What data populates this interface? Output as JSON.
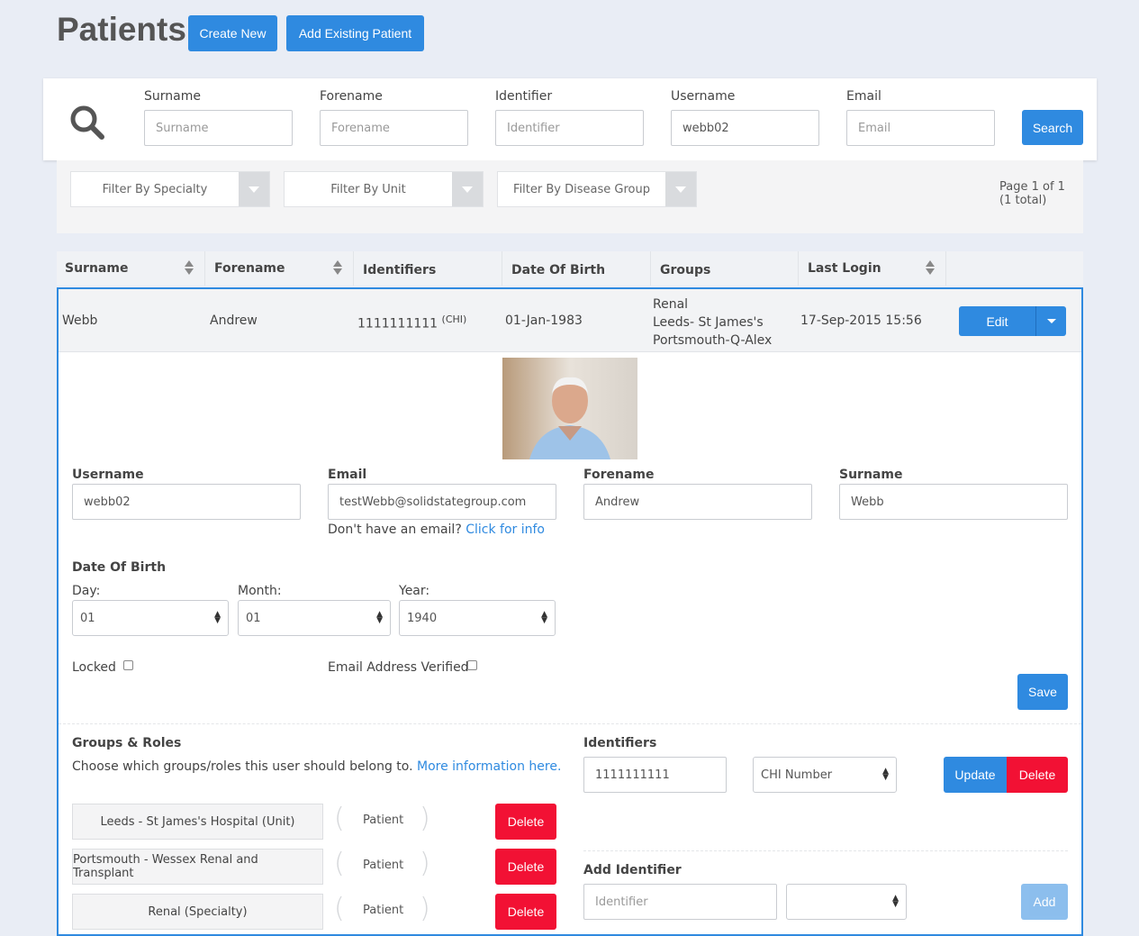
{
  "header": {
    "title": "Patients",
    "create_new": "Create New",
    "add_existing": "Add Existing Patient"
  },
  "search": {
    "icon": "search-icon",
    "surname_label": "Surname",
    "surname_placeholder": "Surname",
    "forename_label": "Forename",
    "forename_placeholder": "Forename",
    "identifier_label": "Identifier",
    "identifier_placeholder": "Identifier",
    "username_label": "Username",
    "username_value": "webb02",
    "email_label": "Email",
    "email_placeholder": "Email",
    "search_button": "Search"
  },
  "filters": {
    "specialty": "Filter By Specialty",
    "unit": "Filter By Unit",
    "disease_group": "Filter By Disease Group",
    "page_info_line1": "Page 1 of 1",
    "page_info_line2": "(1 total)"
  },
  "table": {
    "headers": [
      "Surname",
      "Forename",
      "Identifiers",
      "Date Of Birth",
      "Groups",
      "Last Login"
    ],
    "row": {
      "surname": "Webb",
      "forename": "Andrew",
      "identifier": "1111111111",
      "identifier_type": "(CHI)",
      "dob": "01-Jan-1983",
      "groups": [
        "Renal",
        "Leeds- St James's",
        "Portsmouth-Q-Alex"
      ],
      "last_login": "17-Sep-2015 15:56",
      "edit_button": "Edit"
    }
  },
  "detail": {
    "username_label": "Username",
    "username_value": "webb02",
    "email_label": "Email",
    "email_value": "testWebb@solidstategroup.com",
    "no_email_text": "Don't have an email?",
    "no_email_link": "Click for info",
    "forename_label": "Forename",
    "forename_value": "Andrew",
    "surname_label": "Surname",
    "surname_value": "Webb",
    "dob_label": "Date Of Birth",
    "day_label": "Day:",
    "day_value": "01",
    "month_label": "Month:",
    "month_value": "01",
    "year_label": "Year:",
    "year_value": "1940",
    "locked_label": "Locked",
    "email_verified_label": "Email Address Verified",
    "save_button": "Save"
  },
  "groups_roles": {
    "title": "Groups & Roles",
    "description": "Choose which groups/roles this user should belong to.",
    "more_info_link": "More information here.",
    "items": [
      {
        "group": "Leeds - St James's Hospital (Unit)",
        "role": "Patient",
        "delete": "Delete"
      },
      {
        "group": "Portsmouth - Wessex Renal and Transplant",
        "role": "Patient",
        "delete": "Delete"
      },
      {
        "group": "Renal (Specialty)",
        "role": "Patient",
        "delete": "Delete"
      }
    ]
  },
  "identifiers": {
    "title": "Identifiers",
    "value": "1111111111",
    "type": "CHI Number",
    "update_button": "Update",
    "delete_button": "Delete",
    "add_title": "Add Identifier",
    "add_placeholder": "Identifier",
    "add_button": "Add"
  },
  "colors": {
    "primary": "#2f8ae0",
    "danger": "#f21134",
    "background": "#e9edf5"
  }
}
